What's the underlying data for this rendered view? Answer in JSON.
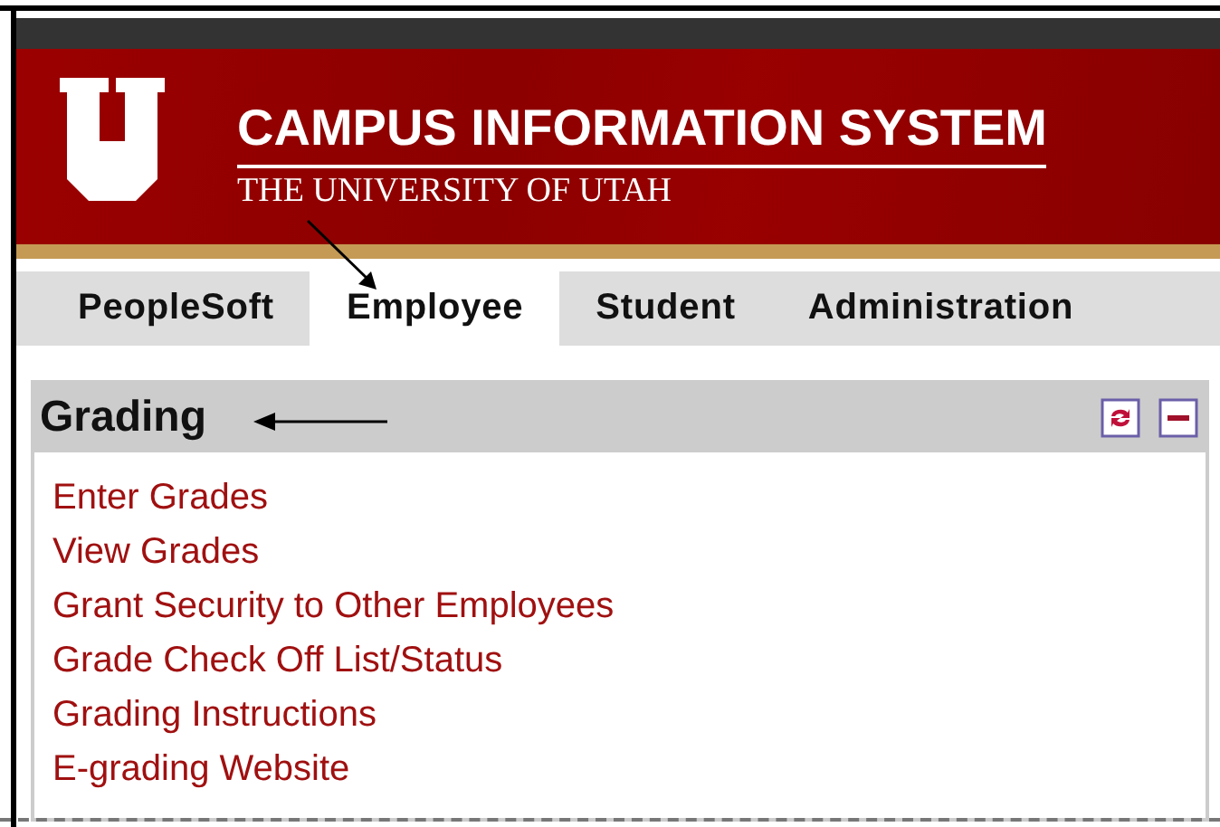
{
  "banner": {
    "title": "CAMPUS INFORMATION SYSTEM",
    "subtitle": "THE UNIVERSITY OF UTAH"
  },
  "tabs": [
    {
      "label": "PeopleSoft",
      "selected": false
    },
    {
      "label": "Employee",
      "selected": true
    },
    {
      "label": "Student",
      "selected": false
    },
    {
      "label": "Administration",
      "selected": false
    }
  ],
  "panel": {
    "title": "Grading",
    "links": [
      "Enter Grades",
      "View Grades",
      "Grant Security to Other Employees",
      "Grade Check Off List/Status",
      "Grading Instructions",
      "E-grading Website"
    ]
  }
}
